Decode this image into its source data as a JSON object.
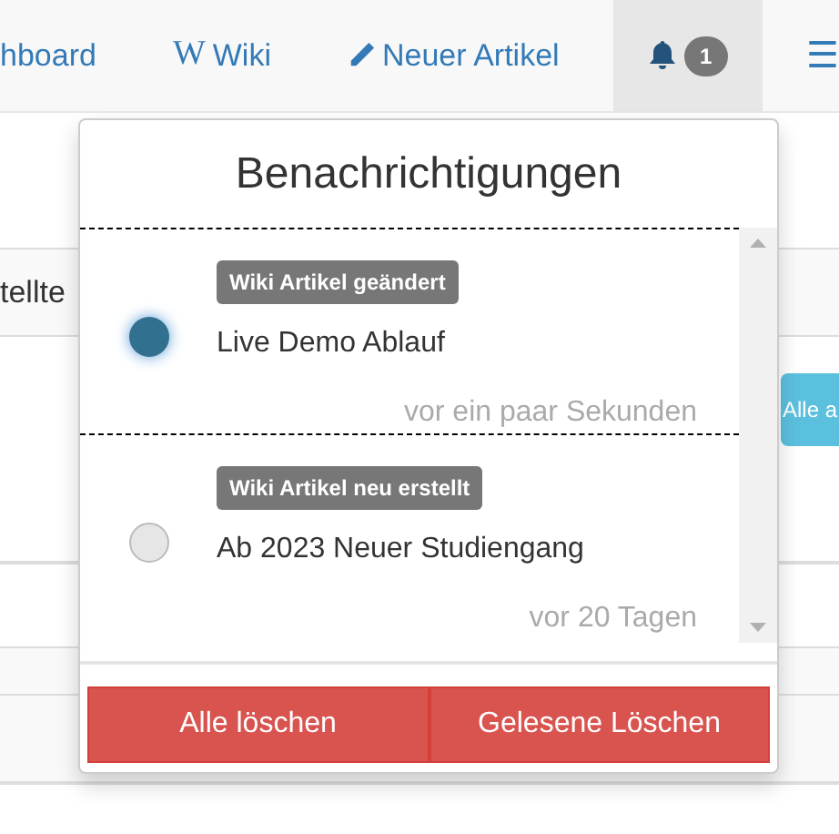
{
  "navbar": {
    "items": [
      {
        "kind": "text",
        "label": "hboard"
      },
      {
        "kind": "wiki",
        "icon_text": "W",
        "label": "Wiki"
      },
      {
        "kind": "pencil",
        "label": "Neuer Artikel"
      }
    ],
    "bell": {
      "count": "1",
      "selected": true
    },
    "menu_glyph": "☰"
  },
  "background": {
    "column_header": "tellte",
    "button": "Alle a"
  },
  "dropdown": {
    "title": "Benachrichtigungen",
    "notifications": [
      {
        "tag": "Wiki Artikel geändert",
        "title": "Live Demo Ablauf",
        "time": "vor ein paar Sekunden",
        "unread": true
      },
      {
        "tag": "Wiki Artikel neu erstellt",
        "title": "Ab 2023 Neuer Studiengang",
        "time": "vor 20 Tagen",
        "unread": false
      }
    ],
    "buttons": [
      "Alle löschen",
      "Gelesene Löschen"
    ]
  }
}
